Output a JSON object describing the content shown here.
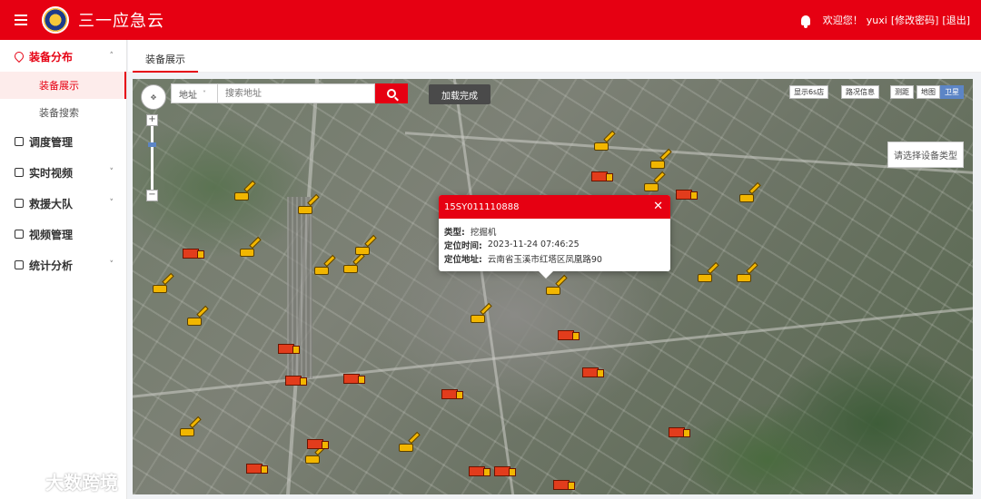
{
  "app": {
    "title": "三一应急云",
    "colors": {
      "brand": "#e60012",
      "active_bg": "#fdeceb"
    }
  },
  "header": {
    "welcome": "欢迎您！",
    "user": "yuxi",
    "change_password": "[修改密码]",
    "logout": "[退出]",
    "icons": [
      "menu-icon",
      "bell-icon"
    ]
  },
  "sidebar": {
    "groups": [
      {
        "label": "装备分布",
        "icon": "location-pin-icon",
        "chevron": "˄",
        "active": true,
        "children": [
          {
            "label": "装备展示",
            "active": true
          },
          {
            "label": "装备搜索",
            "active": false
          }
        ]
      },
      {
        "label": "调度管理",
        "icon": "dispatch-icon",
        "chevron": ""
      },
      {
        "label": "实时视频",
        "icon": "video-icon",
        "chevron": "˅"
      },
      {
        "label": "救援大队",
        "icon": "team-icon",
        "chevron": "˅"
      },
      {
        "label": "视频管理",
        "icon": "video-manage-icon",
        "chevron": ""
      },
      {
        "label": "统计分析",
        "icon": "chart-icon",
        "chevron": "˅"
      }
    ]
  },
  "tabs": [
    {
      "label": "装备展示",
      "active": true
    }
  ],
  "map": {
    "search": {
      "type_selected": "地址",
      "placeholder": "搜索地址"
    },
    "load_status": "加载完成",
    "controls": {
      "show_shop": "显示6s店",
      "traffic": "路况信息",
      "measure": "测距",
      "map_type": [
        "地图",
        "卫星"
      ],
      "map_type_active": "卫星"
    },
    "device_type_select": "请选择设备类型",
    "popup": {
      "title": "15SY011110888",
      "rows": [
        {
          "label": "类型:",
          "value": "挖掘机"
        },
        {
          "label": "定位时间:",
          "value": "2023-11-24 07:46:25"
        },
        {
          "label": "定位地址:",
          "value": "云南省玉溪市红塔区凤凰路90"
        }
      ]
    }
  },
  "watermark": "大数跨境"
}
